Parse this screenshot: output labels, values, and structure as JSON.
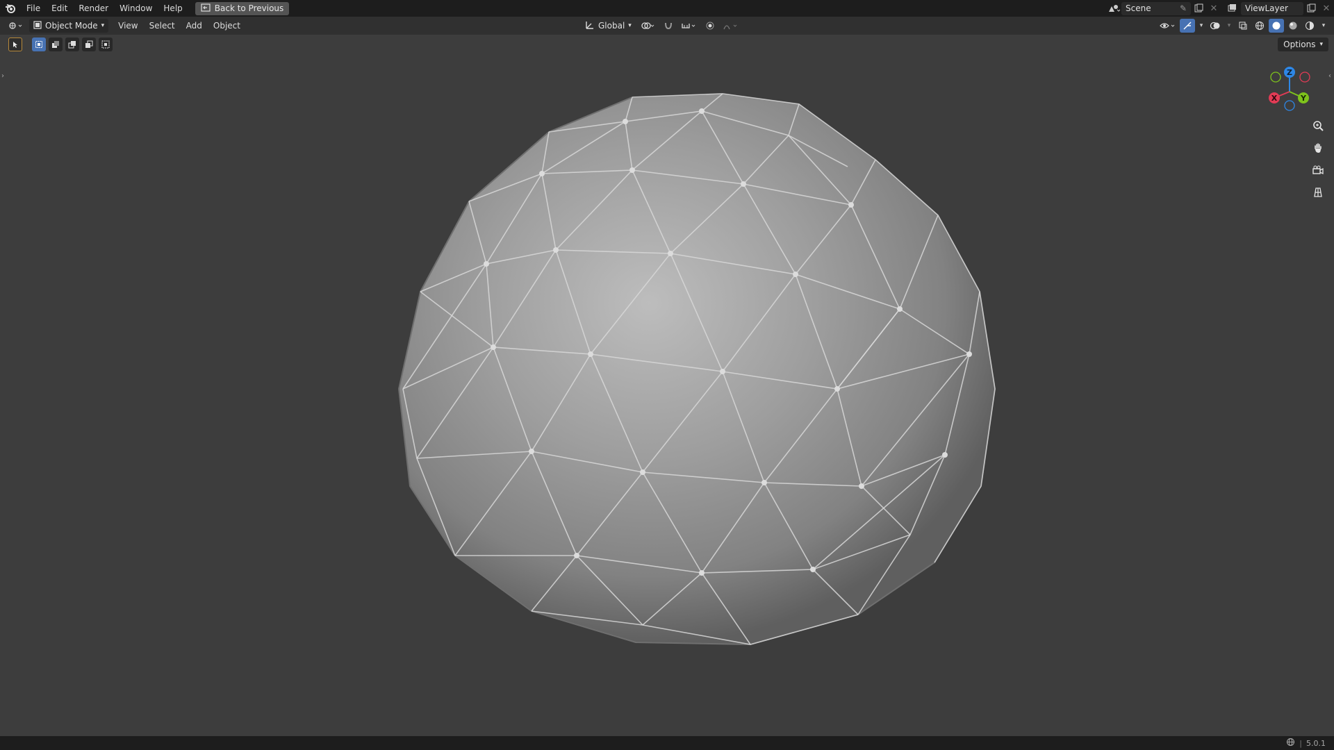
{
  "topbar": {
    "menus": [
      "File",
      "Edit",
      "Render",
      "Window",
      "Help"
    ],
    "back_label": "Back to Previous",
    "scene": "Scene",
    "view_layer": "ViewLayer"
  },
  "header": {
    "mode": "Object Mode",
    "menus": [
      "View",
      "Select",
      "Add",
      "Object"
    ],
    "orientation": "Global",
    "options_label": "Options"
  },
  "gizmo": {
    "z_label": "Z",
    "x_label": "X",
    "y_label": "Y"
  },
  "status": {
    "version": "5.0.1"
  },
  "colors": {
    "accent": "#4772b3",
    "x_axis": "#e23b55",
    "y_axis": "#7ec31c",
    "z_axis": "#2e87e6"
  }
}
